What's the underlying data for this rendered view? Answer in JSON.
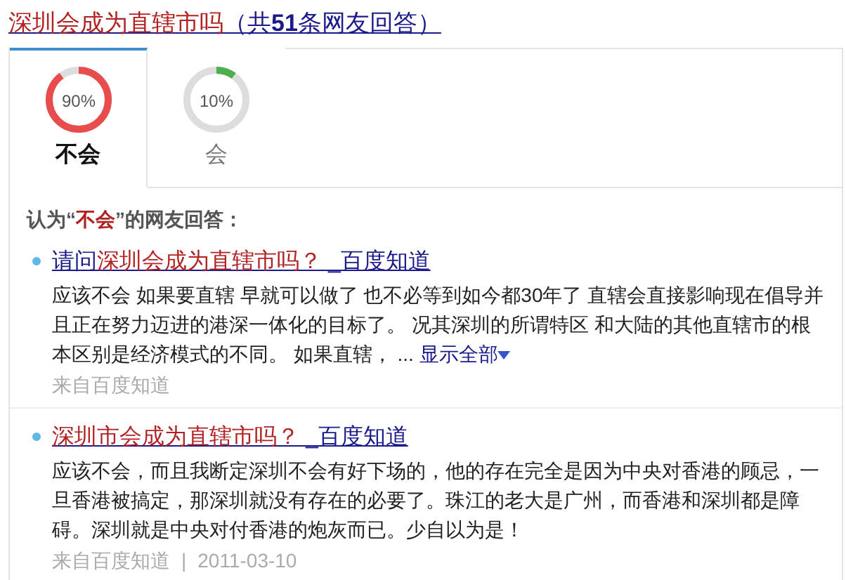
{
  "title": {
    "segments": [
      {
        "text": "深圳会成为直辖市吗",
        "highlight": true
      },
      {
        "text": "（共**51**条网友回答）",
        "highlight": false
      }
    ]
  },
  "tabs": [
    {
      "label": "不会",
      "percent": "90%",
      "kind": "against",
      "selected": true
    },
    {
      "label": "会",
      "percent": "10%",
      "kind": "for",
      "selected": false
    }
  ],
  "answers_heading": {
    "segments": [
      {
        "text": "认为“",
        "highlight": false
      },
      {
        "text": "不会",
        "highlight": true
      },
      {
        "text": "”的网友回答：",
        "highlight": false
      }
    ]
  },
  "answers": [
    {
      "link_segments": [
        {
          "text": "请问",
          "highlight": false
        },
        {
          "text": "深圳会成为直辖市吗？ ",
          "highlight": true
        },
        {
          "text": "_百度知道",
          "highlight": false
        }
      ],
      "body": "应该不会 如果要直辖 早就可以做了 也不必等到如今都30年了 直辖会直接影响现在倡导并且正在努力迈进的港深一体化的目标了。 况其深圳的所谓特区 和大陆的其他直辖市的根本区别是经济模式的不同。 如果直辖，",
      "ellipsis": "...",
      "more": "显示全部",
      "source": "来自百度知道"
    },
    {
      "link_segments": [
        {
          "text": "深圳市会成为直辖市吗？ ",
          "highlight": true
        },
        {
          "text": "_百度知道",
          "highlight": false
        }
      ],
      "body": "应该不会，而且我断定深圳不会有好下场的，他的存在完全是因为中央对香港的顾忌，一旦香港被搞定，那深圳就没有存在的必要了。珠江的老大是广州，而香港和深圳都是障碍。深圳就是中央对付香港的炮灰而已。少自以为是！",
      "source": "来自百度知道",
      "separator": "|",
      "date": "2011-03-10"
    }
  ]
}
